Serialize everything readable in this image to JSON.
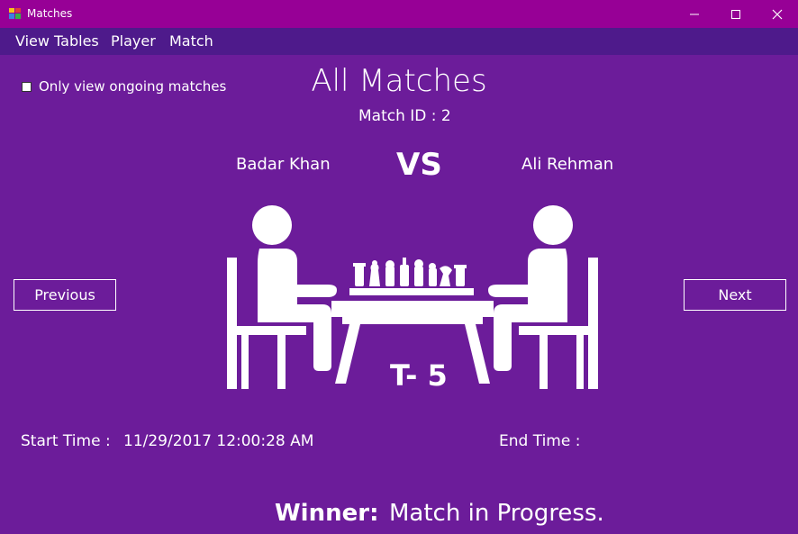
{
  "window": {
    "title": "Matches",
    "minimize_glyph": "—",
    "maximize_glyph": "☐",
    "close_glyph": "✕"
  },
  "menu": {
    "items": [
      {
        "label": "View Tables"
      },
      {
        "label": "Player"
      },
      {
        "label": "Match"
      }
    ]
  },
  "filter": {
    "checkbox_label": "Only view ongoing matches",
    "checked": false
  },
  "header": {
    "title": "All Matches",
    "match_id": "Match ID : 2"
  },
  "match": {
    "player1": "Badar Khan",
    "vs": "VS",
    "player2": "Ali Rehman",
    "table": "T- 5",
    "start_label": "Start Time :",
    "start_value": "11/29/2017 12:00:28 AM",
    "end_label": "End Time :",
    "end_value": ""
  },
  "nav": {
    "previous": "Previous",
    "next": "Next"
  },
  "result": {
    "winner_label": "Winner:",
    "winner_value": "Match in Progress."
  },
  "colors": {
    "background": "#6c1c9a",
    "titlebar": "#970096",
    "menubar": "#4e1a8b",
    "text": "#ffffff"
  },
  "icons": {
    "app": "app-grid-icon",
    "illustration": "chess-players-icon"
  }
}
